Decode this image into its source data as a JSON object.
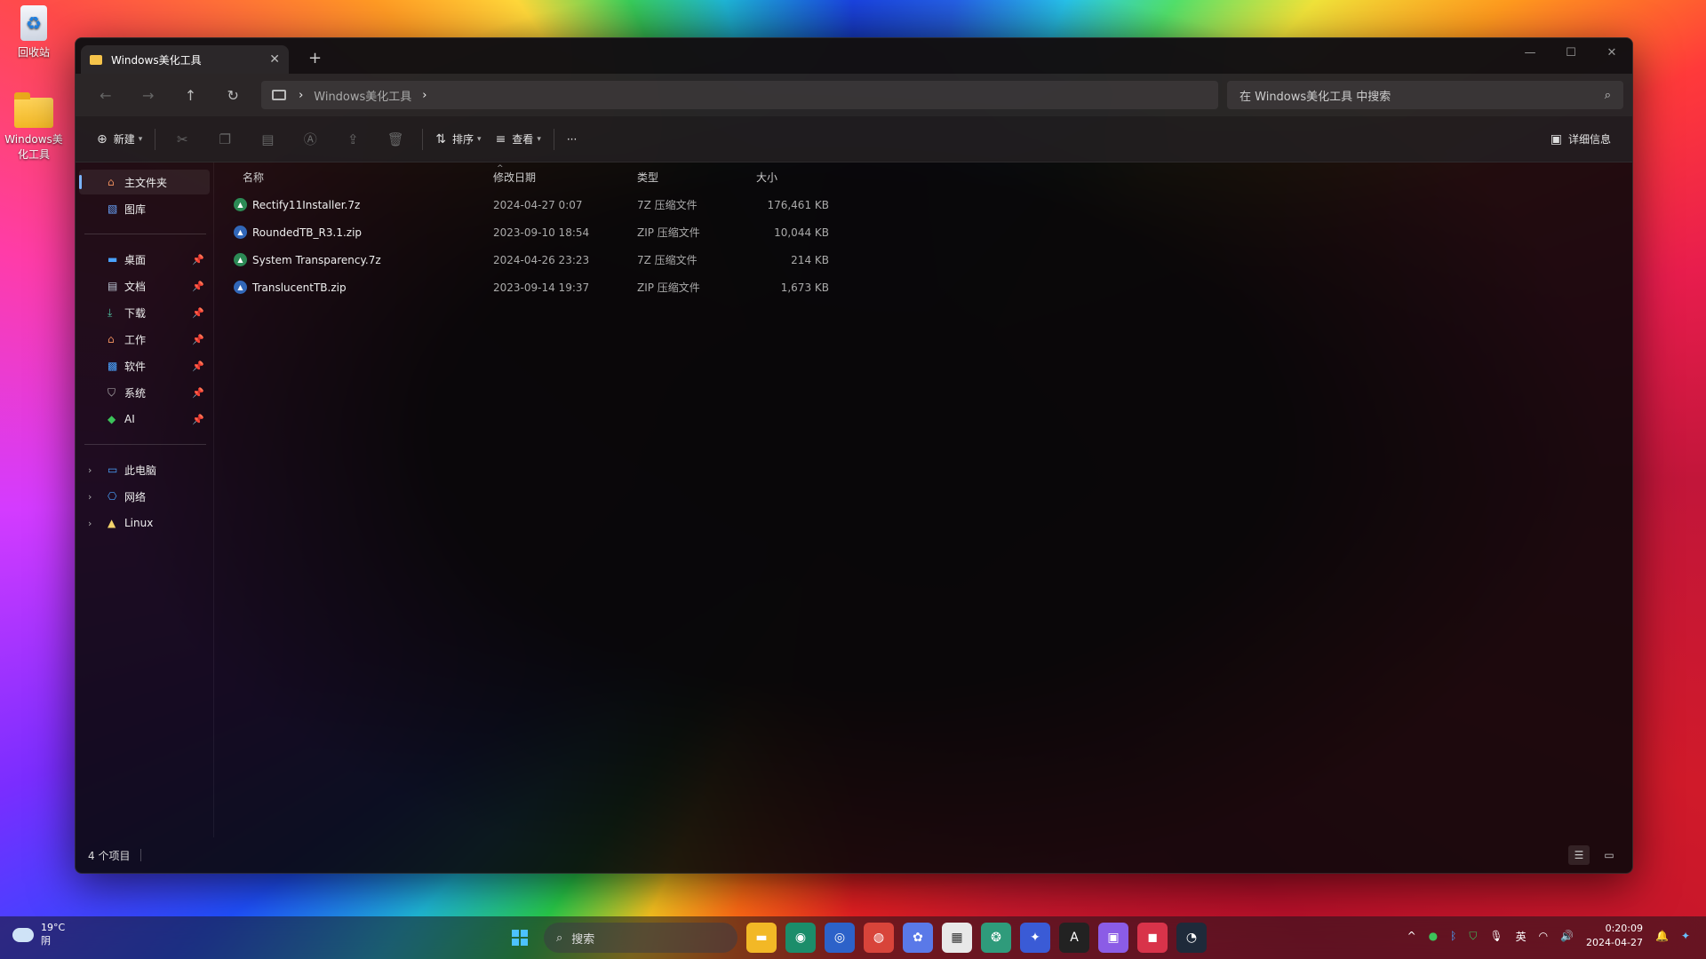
{
  "desktop": {
    "recycle_bin_label": "回收站",
    "folder_label": "Windows美化工具"
  },
  "window": {
    "tab_title": "Windows美化工具",
    "tab_close": "✕",
    "new_tab": "+",
    "minimize": "—",
    "maximize": "☐",
    "close": "✕"
  },
  "navbar": {
    "breadcrumb": "Windows美化工具",
    "search_placeholder": "在 Windows美化工具 中搜索"
  },
  "toolbar": {
    "new_label": "新建",
    "sort_label": "排序",
    "view_label": "查看",
    "more_label": "···",
    "details_label": "详细信息"
  },
  "sidebar": {
    "items": [
      {
        "label": "主文件夹",
        "icon": "home-icon"
      },
      {
        "label": "图库",
        "icon": "gallery-icon"
      }
    ],
    "pinned": [
      {
        "label": "桌面",
        "icon": "desktop-icon"
      },
      {
        "label": "文档",
        "icon": "documents-icon"
      },
      {
        "label": "下载",
        "icon": "download-icon"
      },
      {
        "label": "工作",
        "icon": "work-folder-icon"
      },
      {
        "label": "软件",
        "icon": "software-folder-icon"
      },
      {
        "label": "系统",
        "icon": "system-folder-icon"
      },
      {
        "label": "AI",
        "icon": "ai-folder-icon"
      }
    ],
    "drives": [
      {
        "label": "此电脑",
        "icon": "this-pc-icon"
      },
      {
        "label": "网络",
        "icon": "network-icon"
      },
      {
        "label": "Linux",
        "icon": "linux-icon"
      }
    ]
  },
  "columns": {
    "name": "名称",
    "date": "修改日期",
    "type": "类型",
    "size": "大小"
  },
  "files": [
    {
      "name": "Rectify11Installer.7z",
      "date": "2024-04-27 0:07",
      "type": "7Z 压缩文件",
      "size": "176,461 KB",
      "kind": "sevenz"
    },
    {
      "name": "RoundedTB_R3.1.zip",
      "date": "2023-09-10 18:54",
      "type": "ZIP 压缩文件",
      "size": "10,044 KB",
      "kind": "zip"
    },
    {
      "name": "System Transparency.7z",
      "date": "2024-04-26 23:23",
      "type": "7Z 压缩文件",
      "size": "214 KB",
      "kind": "sevenz"
    },
    {
      "name": "TranslucentTB.zip",
      "date": "2023-09-14 19:37",
      "type": "ZIP 压缩文件",
      "size": "1,673 KB",
      "kind": "zip"
    }
  ],
  "status": {
    "item_count": "4 个项目"
  },
  "taskbar": {
    "temperature": "19°C",
    "weather": "阴",
    "search_label": "搜索",
    "ime": "英",
    "time": "0:20:09",
    "date": "2024-04-27"
  },
  "colors": {
    "accent": "#7ab4ff",
    "archive_7z": "#2c8a55",
    "archive_zip": "#3167b8"
  }
}
